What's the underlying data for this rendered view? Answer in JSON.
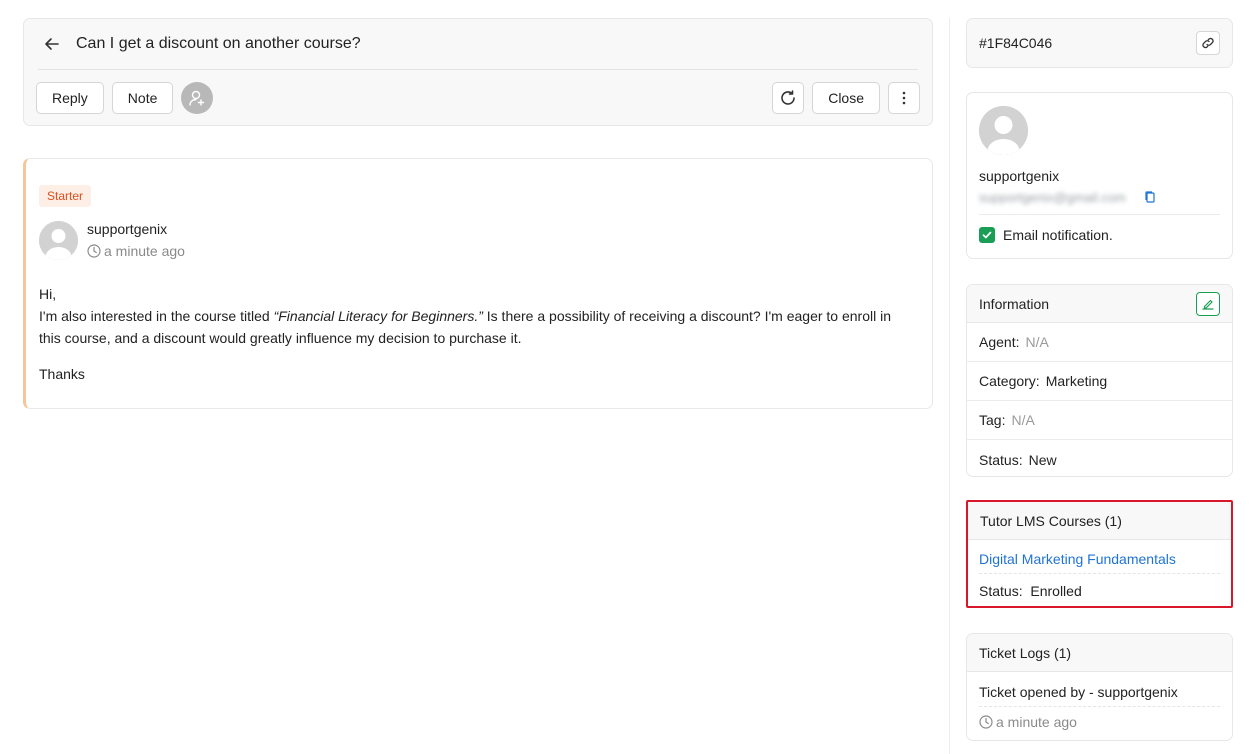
{
  "ticket": {
    "subject": "Can I get a discount on another course?",
    "actions": {
      "reply_label": "Reply",
      "note_label": "Note",
      "close_label": "Close"
    }
  },
  "message": {
    "badge": "Starter",
    "author": "supportgenix",
    "time": "a minute ago",
    "greeting": "Hi,",
    "body_before": "I'm also interested in the course titled ",
    "body_emphasis": "“Financial Literacy for Beginners.”",
    "body_after": " Is there a possibility of receiving a discount? I'm eager to enroll in this course, and a discount would greatly influence my decision to purchase it.",
    "signoff": "Thanks"
  },
  "sidebar": {
    "ticket_id": "#1F84C046",
    "customer": {
      "name": "supportgenix",
      "email": "supportgenix@gmail.com",
      "email_notification_label": "Email notification.",
      "email_notification_checked": true
    },
    "information": {
      "title": "Information",
      "rows": [
        {
          "label": "Agent:",
          "value": "N/A",
          "muted": true
        },
        {
          "label": "Category:",
          "value": "Marketing",
          "muted": false
        },
        {
          "label": "Tag:",
          "value": "N/A",
          "muted": true
        },
        {
          "label": "Status:",
          "value": "New",
          "muted": false
        }
      ]
    },
    "courses": {
      "title": "Tutor LMS Courses (1)",
      "course_name": "Digital Marketing Fundamentals",
      "status_label": "Status:",
      "status_value": "Enrolled"
    },
    "logs": {
      "title": "Ticket Logs (1)",
      "entry": "Ticket opened by - supportgenix",
      "time": "a minute ago"
    }
  },
  "colors": {
    "accent_green": "#1a9e55",
    "link_blue": "#1f73d6",
    "highlight_red": "#d8182a",
    "starter_orange": "#d9501e",
    "message_border": "#f7c59a"
  },
  "icons": [
    "arrow-left-icon",
    "user-plus-icon",
    "refresh-icon",
    "more-vertical-icon",
    "link-icon",
    "copy-icon",
    "check-icon",
    "edit-icon",
    "clock-icon",
    "avatar-icon"
  ]
}
